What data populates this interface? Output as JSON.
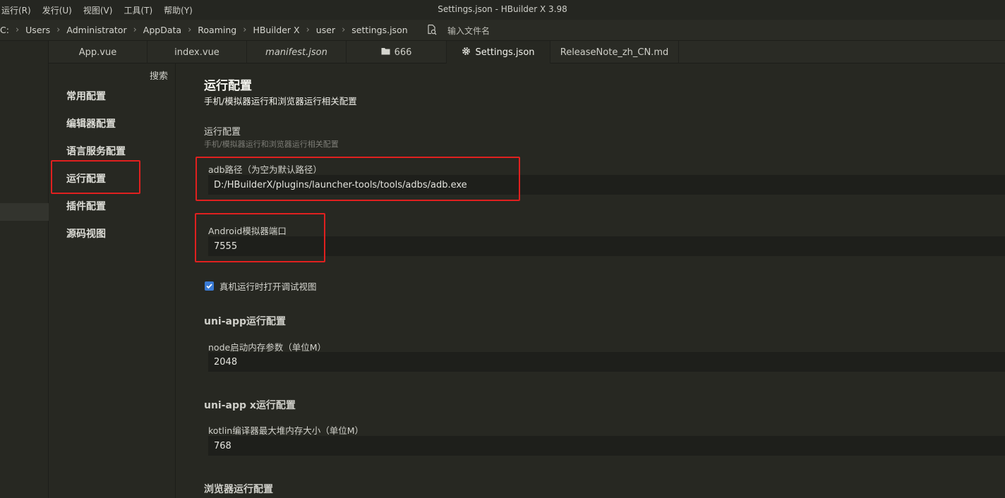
{
  "menu": [
    "运行(R)",
    "发行(U)",
    "视图(V)",
    "工具(T)",
    "帮助(Y)"
  ],
  "window_title": "Settings.json - HBuilder X 3.98",
  "breadcrumb": [
    "C:",
    "Users",
    "Administrator",
    "AppData",
    "Roaming",
    "HBuilder X",
    "user",
    "settings.json"
  ],
  "file_search": {
    "placeholder": "输入文件名",
    "icon": "file-search-icon"
  },
  "tabs": [
    {
      "label": "App.vue",
      "italic": false,
      "active": false
    },
    {
      "label": "index.vue",
      "italic": false,
      "active": false
    },
    {
      "label": "manifest.json",
      "italic": true,
      "active": false
    },
    {
      "label": "666",
      "icon": "folder-icon",
      "italic": false,
      "active": false
    },
    {
      "label": "Settings.json",
      "icon": "gear-icon",
      "italic": false,
      "active": true
    },
    {
      "label": "ReleaseNote_zh_CN.md",
      "italic": false,
      "active": false
    }
  ],
  "settings_nav": {
    "search_label": "搜索",
    "items": [
      "常用配置",
      "编辑器配置",
      "语言服务配置",
      "运行配置",
      "插件配置",
      "源码视图"
    ],
    "active_index": 3
  },
  "content": {
    "title": "运行配置",
    "subtitle": "手机/模拟器运行和浏览器运行相关配置",
    "run_section": {
      "title": "运行配置",
      "description": "手机/模拟器运行和浏览器运行相关配置"
    },
    "adb_path": {
      "label": "adb路径（为空为默认路径）",
      "value": "D:/HBuilderX/plugins/launcher-tools/tools/adbs/adb.exe"
    },
    "android_port": {
      "label": "Android模拟器端口",
      "value": "7555"
    },
    "debug_checkbox": {
      "label": "真机运行时打开调试视图",
      "checked": true
    },
    "uniapp_section": {
      "title": "uni-app运行配置",
      "node_label": "node启动内存参数（单位M）",
      "node_value": "2048"
    },
    "uniappx_section": {
      "title": "uni-app x运行配置",
      "kotlin_label": "kotlin编译器最大堆内存大小（单位M）",
      "kotlin_value": "768"
    },
    "browser_section": {
      "title": "浏览器运行配置"
    }
  },
  "colors": {
    "background": "#272822",
    "input_background": "#1e1f1b",
    "highlight_box": "#e0201f",
    "checkbox": "#3a7bd5"
  }
}
